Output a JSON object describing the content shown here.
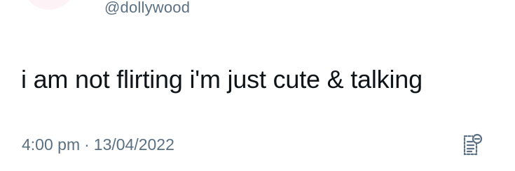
{
  "tweet": {
    "handle": "@dollywood",
    "text": "i am not flirting i'm just cute & talking",
    "time": "4:00 pm",
    "separator": "·",
    "date": "13/04/2022"
  },
  "icons": {
    "avatar": "avatar-image",
    "analytics": "analytics-icon"
  },
  "colors": {
    "text": "#0f1419",
    "secondary": "#5b7083",
    "avatar_bg": "#fdf2f5"
  }
}
